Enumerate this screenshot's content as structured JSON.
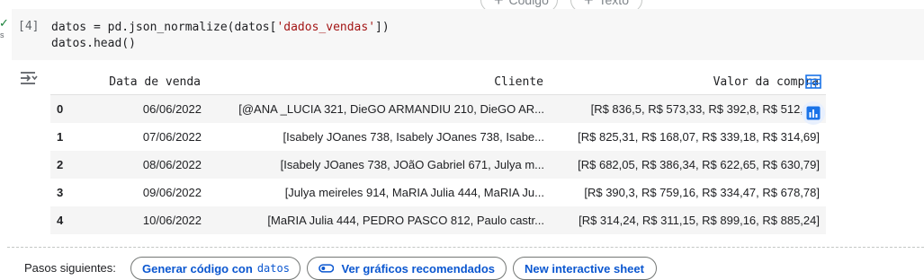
{
  "toolbar": {
    "code_label": "Código",
    "text_label": "Texto"
  },
  "cell": {
    "exec_count": "[4]",
    "line1_pre": "datos = pd.json_normalize(datos[",
    "line1_str": "'dados_vendas'",
    "line1_post": "])",
    "line2": "datos.head()"
  },
  "table": {
    "columns": [
      "Data de venda",
      "Cliente",
      "Valor da compra"
    ],
    "rows": [
      {
        "index": "0",
        "date": "06/06/2022",
        "client": "[@ANA _LUCIA 321, DieGO ARMANDIU 210, DieGO AR...",
        "valor": "[R$ 836,5, R$ 573,33, R$ 392,8, R$ 512,34]"
      },
      {
        "index": "1",
        "date": "07/06/2022",
        "client": "[Isabely JOanes 738, Isabely JOanes 738, Isabe...",
        "valor": "[R$ 825,31, R$ 168,07, R$ 339,18, R$ 314,69]"
      },
      {
        "index": "2",
        "date": "08/06/2022",
        "client": "[Isabely JOanes 738, JOãO Gabriel 671, Julya m...",
        "valor": "[R$ 682,05, R$ 386,34, R$ 622,65, R$ 630,79]"
      },
      {
        "index": "3",
        "date": "09/06/2022",
        "client": "[Julya meireles 914, MaRIA Julia 444, MaRIA Ju...",
        "valor": "[R$ 390,3, R$ 759,16, R$ 334,47, R$ 678,78]"
      },
      {
        "index": "4",
        "date": "10/06/2022",
        "client": "[MaRIA Julia 444, PEDRO PASCO 812, Paulo castr...",
        "valor": "[R$ 314,24, R$ 311,15, R$ 899,16, R$ 885,24]"
      }
    ]
  },
  "next_steps": {
    "label": "Pasos siguientes:",
    "generate_code": "Generar código con",
    "generate_code_var": "datos",
    "view_charts": "Ver gráficos recomendados",
    "interactive_sheet": "New interactive sheet"
  },
  "colors": {
    "accent": "#0b57d0",
    "side_button_bg": "#e8f0fe",
    "cell_bg": "#f7f7f7"
  }
}
